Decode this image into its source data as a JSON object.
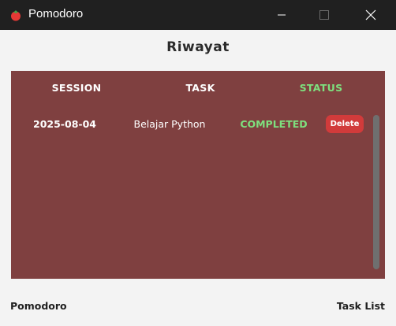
{
  "window": {
    "title": "Pomodoro",
    "icon": "tomato-icon"
  },
  "page": {
    "title": "Riwayat"
  },
  "table": {
    "headers": {
      "session": "SESSION",
      "task": "TASK",
      "status": "STATUS"
    },
    "rows": [
      {
        "session": "2025-08-04",
        "task": "Belajar Python",
        "status": "COMPLETED",
        "action": "Delete"
      }
    ]
  },
  "footer": {
    "left": "Pomodoro",
    "right": "Task List"
  },
  "colors": {
    "panel_bg": "#7f4040",
    "status_green": "#7ee07e",
    "delete_red": "#d13b3b",
    "titlebar_bg": "#202020"
  }
}
